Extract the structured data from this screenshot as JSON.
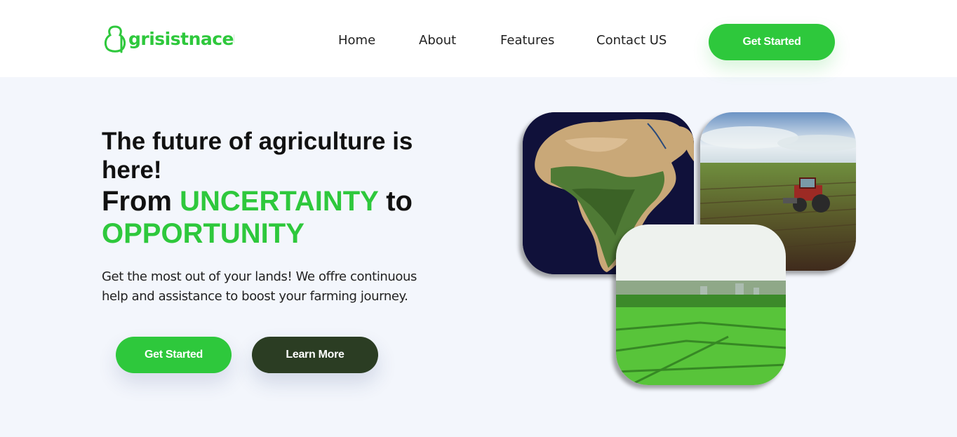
{
  "header": {
    "logo_text": "grisistnace",
    "nav": {
      "home": "Home",
      "about": "About",
      "features": "Features",
      "contact": "Contact US"
    },
    "cta_label": "Get Started"
  },
  "hero": {
    "headline": "The future of agriculture is here!",
    "subhead_prefix": "From ",
    "subhead_highlight1": "UNCERTAINTY",
    "subhead_middle": " to ",
    "subhead_highlight2": "OPPORTUNITY",
    "description": "Get the most out of your lands! We offre continuous help and assistance to boost your farming journey.",
    "primary_button": "Get Started",
    "secondary_button": "Learn More"
  },
  "colors": {
    "brand_green": "#2ec83c",
    "dark_green": "#2b3d23",
    "page_bg": "#f3f6fc"
  },
  "images": {
    "africa": "africa-satellite-image",
    "tractor": "tractor-field-image",
    "field": "green-crop-field-image"
  }
}
